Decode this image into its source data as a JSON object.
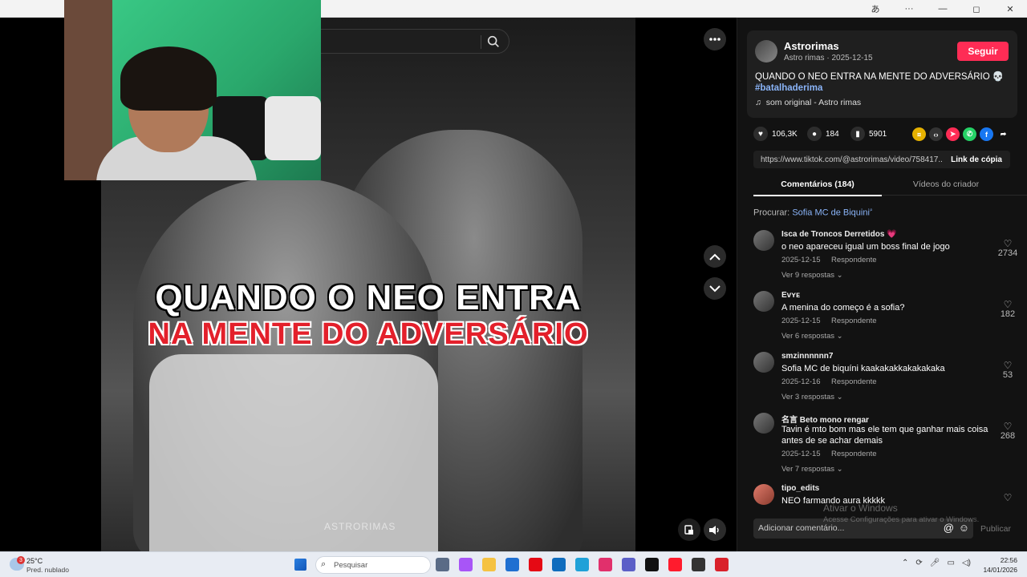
{
  "window": {
    "minimize": "—",
    "maximize": "◻",
    "close": "✕",
    "more": "···",
    "translate": "あ"
  },
  "video": {
    "caption_line1": "QUANDO O NEO ENTRA",
    "caption_line2": "NA MENTE DO ADVERSÁRIO",
    "watermark": "ASTRORIMAS"
  },
  "author": {
    "name": "Astrorimas",
    "meta": "Astro rimas · 2025-12-15",
    "follow_label": "Seguir",
    "description": "QUANDO O NEO ENTRA NA MENTE DO ADVERSÁRIO 💀",
    "hashtag": "#batalhaderima",
    "music": "som original - Astro rimas"
  },
  "stats": {
    "likes": "106,3K",
    "comments": "184",
    "saves": "5901"
  },
  "link": {
    "url": "https://www.tiktok.com/@astrorimas/video/758417...",
    "copy_label": "Link de cópia"
  },
  "tabs": {
    "comments": "Comentários (184)",
    "creator_videos": "Vídeos do criador"
  },
  "suggest": {
    "prefix": "Procurar:",
    "term": "Sofia MC de Biquini"
  },
  "comments": [
    {
      "user": "Isca de Troncos Derretidos 💗",
      "text": "o neo apareceu igual um boss final de jogo",
      "date": "2025-12-15",
      "reply": "Respondente",
      "more": "Ver 9 respostas ⌄",
      "likes": "2734"
    },
    {
      "user": "Evʏᴇ",
      "text": "A menina do começo é a sofia?",
      "date": "2025-12-15",
      "reply": "Respondente",
      "more": "Ver 6 respostas ⌄",
      "likes": "182"
    },
    {
      "user": "smzinnnnnn7",
      "text": "Sofia MC de biquíni kaakakakkakakakaka",
      "date": "2025-12-16",
      "reply": "Respondente",
      "more": "Ver 3 respostas ⌄",
      "likes": "53"
    },
    {
      "user": "名言 Beto mono rengar",
      "text": "Tavin é mto bom mas ele tem que ganhar mais coisa antes de se achar demais",
      "date": "2025-12-15",
      "reply": "Respondente",
      "more": "Ver 7 respostas ⌄",
      "likes": "268"
    },
    {
      "user": "tipo_edits",
      "text": "NEO farmando aura kkkkk",
      "date": "",
      "reply": "",
      "more": "",
      "likes": ""
    }
  ],
  "activation": {
    "line1": "Ativar o Windows",
    "line2": "Acesse Configurações para ativar o Windows."
  },
  "composer": {
    "placeholder": "Adicionar comentário...",
    "at": "@",
    "emoji": "☺",
    "publish": "Publicar"
  },
  "taskbar": {
    "temp": "25°C",
    "weather": "Pred. nublado",
    "weather_badge": "3",
    "search_placeholder": "Pesquisar",
    "time": "22:56",
    "date": "14/01/2026"
  },
  "colors": {
    "accent": "#fe2c55",
    "link": "#8ab4f8",
    "panel_bg": "#121212"
  }
}
